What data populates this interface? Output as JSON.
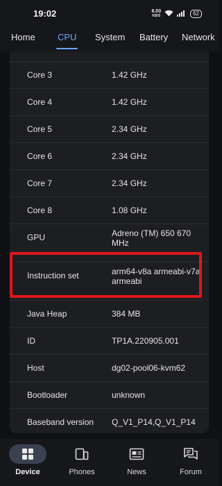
{
  "status": {
    "time": "19:02",
    "speed_value": "6.00",
    "speed_unit": "KB/S",
    "battery": "62"
  },
  "tabs": [
    {
      "label": "Home"
    },
    {
      "label": "CPU"
    },
    {
      "label": "System"
    },
    {
      "label": "Battery"
    },
    {
      "label": "Network"
    }
  ],
  "rows": [
    {
      "label": "Core 3",
      "value": "1.42 GHz"
    },
    {
      "label": "Core 4",
      "value": "1.42 GHz"
    },
    {
      "label": "Core 5",
      "value": "2.34 GHz"
    },
    {
      "label": "Core 6",
      "value": "2.34 GHz"
    },
    {
      "label": "Core 7",
      "value": "2.34 GHz"
    },
    {
      "label": "Core 8",
      "value": "1.08 GHz"
    },
    {
      "label": "GPU",
      "value": "Adreno (TM) 650 670 MHz"
    },
    {
      "label": "Instruction set",
      "value": "arm64-v8a armeabi-v7a armeabi"
    },
    {
      "label": "Java Heap",
      "value": "384 MB"
    },
    {
      "label": "ID",
      "value": "TP1A.220905.001"
    },
    {
      "label": "Host",
      "value": "dg02-pool06-kvm62"
    },
    {
      "label": "Bootloader",
      "value": "unknown"
    },
    {
      "label": "Baseband version",
      "value": "Q_V1_P14,Q_V1_P14"
    }
  ],
  "nav": [
    {
      "label": "Device",
      "icon": "device-icon"
    },
    {
      "label": "Phones",
      "icon": "phones-icon"
    },
    {
      "label": "News",
      "icon": "news-icon"
    },
    {
      "label": "Forum",
      "icon": "forum-icon"
    }
  ],
  "colors": {
    "accent": "#66a9ff",
    "highlight": "#e0161b",
    "background": "#101114",
    "panel": "#1d1e22"
  }
}
